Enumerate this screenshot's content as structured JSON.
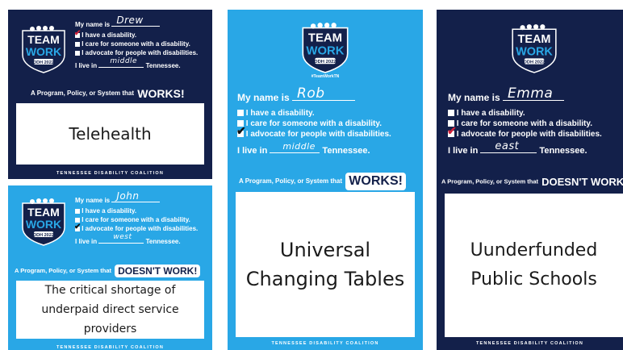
{
  "form": {
    "name_prefix": "My name is",
    "opt_disability": "I have a disability.",
    "opt_care": "I care for someone with a disability.",
    "opt_advocate": "I advocate for people with disabilities.",
    "live_prefix": "I live in",
    "live_suffix": "Tennessee.",
    "program_prefix": "A Program, Policy, or System that",
    "works": "WORKS!",
    "doesnt_work": "DOESN'T WORK!",
    "footer": "TENNESSEE DISABILITY COALITION"
  },
  "logo": {
    "line1": "TEAM",
    "line2": "WORK",
    "year": "DDH 2022"
  },
  "hashtag": "#TeamWorkTN",
  "colors": {
    "navy": "#13204a",
    "blue": "#29a7e6",
    "check_red": "#d2213a"
  },
  "cards": [
    {
      "name": "Drew",
      "region": "middle",
      "checked": "disability",
      "verdict": "works",
      "response": "Telehealth"
    },
    {
      "name": "John",
      "region": "west",
      "checked": "advocate",
      "verdict": "doesnt",
      "response": "The critical shortage of underpaid direct service providers"
    },
    {
      "name": "Rob",
      "region": "middle",
      "checked": "advocate",
      "verdict": "works",
      "response": "Universal Changing Tables"
    },
    {
      "name": "Emma",
      "region": "east",
      "checked": "advocate",
      "verdict": "doesnt",
      "response": "Uunderfunded Public Schools"
    }
  ]
}
